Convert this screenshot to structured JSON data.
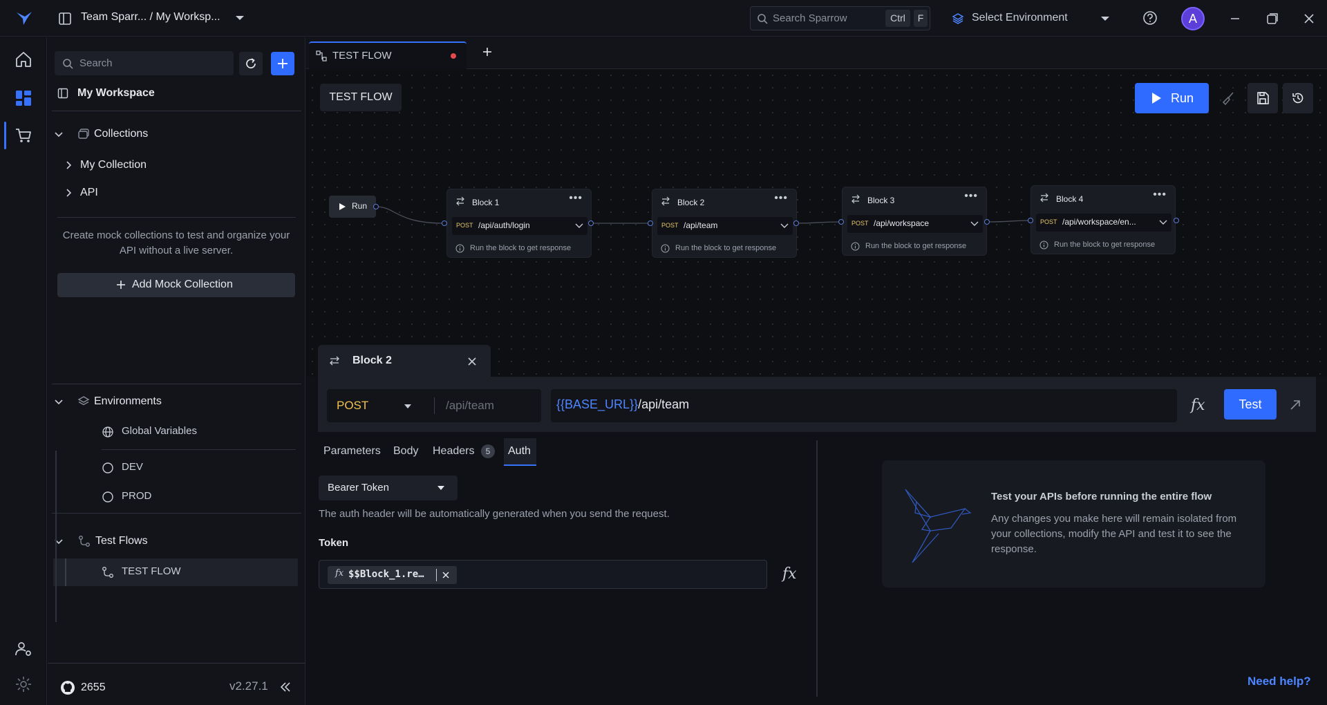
{
  "titlebar": {
    "workspace_path": "Team Sparr... / My Worksp...",
    "search_placeholder": "Search Sparrow",
    "search_shortcut_mod": "Ctrl",
    "search_shortcut_key": "F",
    "environment_select": "Select Environment",
    "avatar_initial": "A"
  },
  "sidebar": {
    "search_placeholder": "Search",
    "workspace_name": "My Workspace",
    "collections_label": "Collections",
    "collections": [
      {
        "label": "My Collection"
      },
      {
        "label": "API"
      }
    ],
    "mock_description": "Create mock collections to test and organize your API without a live server.",
    "add_mock_label": "Add Mock Collection",
    "environments_label": "Environments",
    "global_variables": "Global Variables",
    "environments": [
      {
        "label": "DEV"
      },
      {
        "label": "PROD"
      }
    ],
    "test_flows_label": "Test Flows",
    "test_flows": [
      {
        "label": "TEST FLOW"
      }
    ],
    "github_stars": "2655",
    "version": "v2.27.1"
  },
  "tabs": [
    {
      "label": "TEST FLOW",
      "unsaved": true
    }
  ],
  "flow": {
    "title": "TEST FLOW",
    "run_label": "Run",
    "start_label": "Run",
    "blocks": [
      {
        "name": "Block 1",
        "method": "POST",
        "path": "/api/auth/login",
        "hint": "Run the block to get response"
      },
      {
        "name": "Block 2",
        "method": "POST",
        "path": "/api/team",
        "hint": "Run the block to get response"
      },
      {
        "name": "Block 3",
        "method": "POST",
        "path": "/api/workspace",
        "hint": "Run the block to get response"
      },
      {
        "name": "Block 4",
        "method": "POST",
        "path": "/api/workspace/en...",
        "hint": "Run the block to get response"
      }
    ]
  },
  "panel": {
    "block_name": "Block 2",
    "method": "POST",
    "path_placeholder": "/api/team",
    "url_variable": "{{BASE_URL}}",
    "url_path": "/api/team",
    "test_label": "Test",
    "subtabs": {
      "parameters": "Parameters",
      "body": "Body",
      "headers": "Headers",
      "headers_count": "5",
      "auth": "Auth"
    },
    "auth_type": "Bearer Token",
    "auth_note": "The auth header will be automatically generated when you send the request.",
    "token_label": "Token",
    "token_value": "$$Block_1.re…",
    "info_title": "Test your APIs before running the entire flow",
    "info_desc": "Any changes you make here will remain isolated from your collections, modify the API and test it to see the response.",
    "need_help": "Need help?"
  },
  "colors": {
    "accent": "#2f6bff",
    "method_post": "#f2c14e",
    "url_variable": "#4d86ff",
    "unsaved_dot": "#e5484d"
  }
}
